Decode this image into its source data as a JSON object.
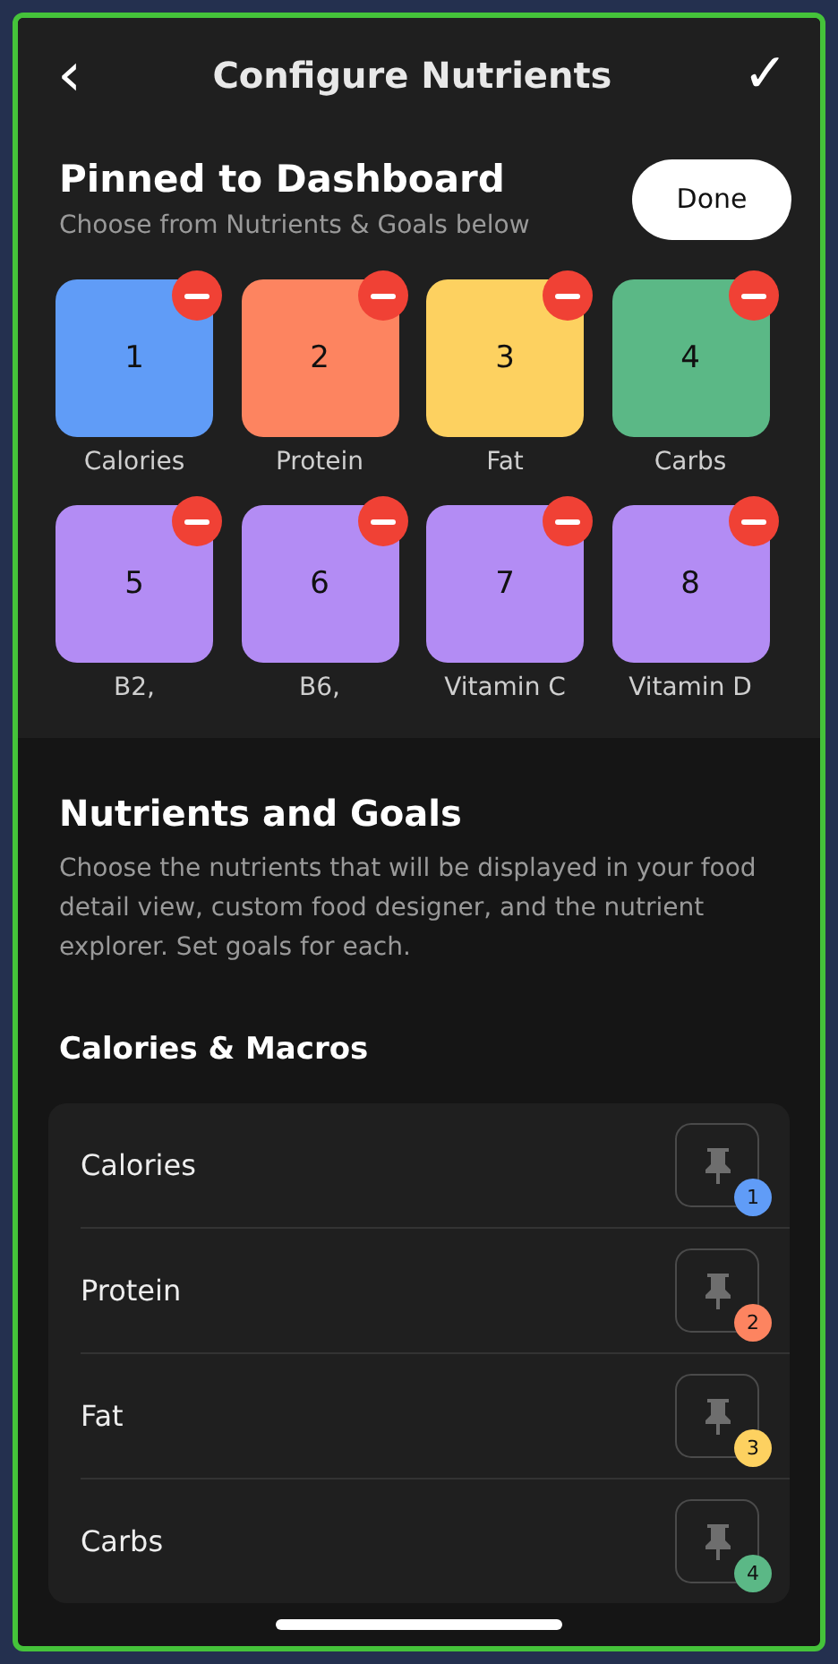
{
  "header": {
    "back": "‹",
    "title": "Configure Nutrients",
    "confirm": "✓"
  },
  "pinned": {
    "title": "Pinned to Dashboard",
    "subtitle": "Choose from Nutrients & Goals below",
    "done": "Done",
    "tiles": [
      {
        "number": "1",
        "label": "Calories",
        "color": "#609cf7"
      },
      {
        "number": "2",
        "label": "Protein",
        "color": "#fd8460"
      },
      {
        "number": "3",
        "label": "Fat",
        "color": "#fdd160"
      },
      {
        "number": "4",
        "label": "Carbs",
        "color": "#5bb886"
      },
      {
        "number": "5",
        "label": "B2,",
        "color": "#b38cf4"
      },
      {
        "number": "6",
        "label": "B6,",
        "color": "#b38cf4"
      },
      {
        "number": "7",
        "label": "Vitamin C",
        "color": "#b38cf4"
      },
      {
        "number": "8",
        "label": "Vitamin D",
        "color": "#b38cf4"
      }
    ]
  },
  "nutrients": {
    "title": "Nutrients and Goals",
    "description": "Choose the nutrients that will be displayed in your food detail view, custom food designer, and the nutrient explorer. Set goals for each.",
    "group": "Calories & Macros",
    "rows": [
      {
        "label": "Calories",
        "pin": "1",
        "color": "#609cf7"
      },
      {
        "label": "Protein",
        "pin": "2",
        "color": "#fd8460"
      },
      {
        "label": "Fat",
        "pin": "3",
        "color": "#fdd160"
      },
      {
        "label": "Carbs",
        "pin": "4",
        "color": "#5bb886"
      }
    ]
  }
}
